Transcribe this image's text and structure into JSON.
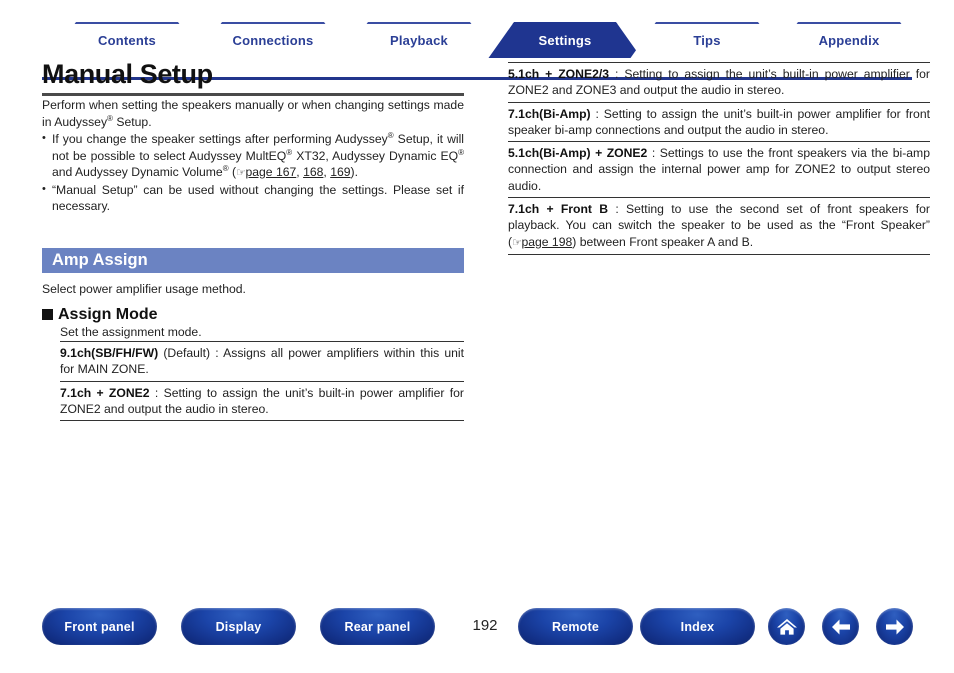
{
  "tabs": [
    {
      "label": "Contents",
      "active": false
    },
    {
      "label": "Connections",
      "active": false
    },
    {
      "label": "Playback",
      "active": false
    },
    {
      "label": "Settings",
      "active": true
    },
    {
      "label": "Tips",
      "active": false
    },
    {
      "label": "Appendix",
      "active": false
    }
  ],
  "page": {
    "title": "Manual Setup",
    "number": "192"
  },
  "intro": {
    "paragraph": "Perform when setting the speakers manually or when changing settings made in Audyssey® Setup.",
    "bullets": [
      "If you change the speaker settings after performing Audyssey® Setup, it will not be possible to select Audyssey MultEQ® XT32, Audyssey Dynamic EQ® and Audyssey Dynamic Volume® (☞page 167, 168, 169).",
      "“Manual Setup” can be used without changing the settings. Please set if necessary."
    ],
    "bullet1_pre": "If you change the speaker settings after performing Audyssey",
    "bullet1_mid": " Setup, it will not be possible to select Audyssey MultEQ",
    "bullet1_post": " XT32, Audyssey Dynamic EQ",
    "bullet1_post2": " and Audyssey Dynamic Volume",
    "bullet1_refs": [
      "page 167",
      "168",
      "169"
    ],
    "bullet2": "“Manual Setup” can be used without changing the settings. Please set if necessary."
  },
  "section": {
    "heading": "Amp Assign",
    "intro": "Select power amplifier usage method.",
    "subsection": {
      "heading": "Assign Mode",
      "description": "Set the assignment mode."
    }
  },
  "assign_modes_left": [
    {
      "term": "9.1ch(SB/FH/FW)",
      "qualifier": " (Default)",
      "separator": " : ",
      "body": "Assigns all power amplifiers within this unit for MAIN ZONE."
    },
    {
      "term": "7.1ch + ZONE2",
      "qualifier": "",
      "separator": " : ",
      "body": "Setting to assign the unit’s built-in power amplifier for ZONE2 and output the audio in stereo."
    }
  ],
  "assign_modes_right": [
    {
      "term": "5.1ch + ZONE2/3",
      "qualifier": "",
      "separator": " : ",
      "body": "Setting to assign the unit’s built-in power amplifier for ZONE2 and ZONE3 and output the audio in stereo."
    },
    {
      "term": "7.1ch(Bi-Amp)",
      "qualifier": "",
      "separator": " : ",
      "body": "Setting to assign the unit’s built-in power amplifier for front speaker bi-amp connections and output the audio in stereo."
    },
    {
      "term": "5.1ch(Bi-Amp) + ZONE2",
      "qualifier": "",
      "separator": " : ",
      "body": "Settings to use the front speakers via the bi-amp connection and assign the internal power amp for ZONE2 to output stereo audio."
    },
    {
      "term": "7.1ch + Front B",
      "qualifier": "",
      "separator": " : ",
      "body_pre": "Setting to use the second set of front speakers for playback. You can switch the speaker to be used as the “Front Speaker” (",
      "body_ref": "page 198",
      "body_post": ") between Front speaker A and B."
    }
  ],
  "footer": {
    "buttons": [
      {
        "label": "Front panel"
      },
      {
        "label": "Display"
      },
      {
        "label": "Rear panel"
      },
      {
        "label": "Remote"
      },
      {
        "label": "Index"
      }
    ],
    "icons": [
      "home-icon",
      "back-arrow-icon",
      "forward-arrow-icon"
    ]
  },
  "colors": {
    "tab_active_bg": "#1f3590",
    "tab_text": "#2b3f96",
    "section_bar_bg": "#6b83c2",
    "button_blue": "#1b44a8"
  }
}
